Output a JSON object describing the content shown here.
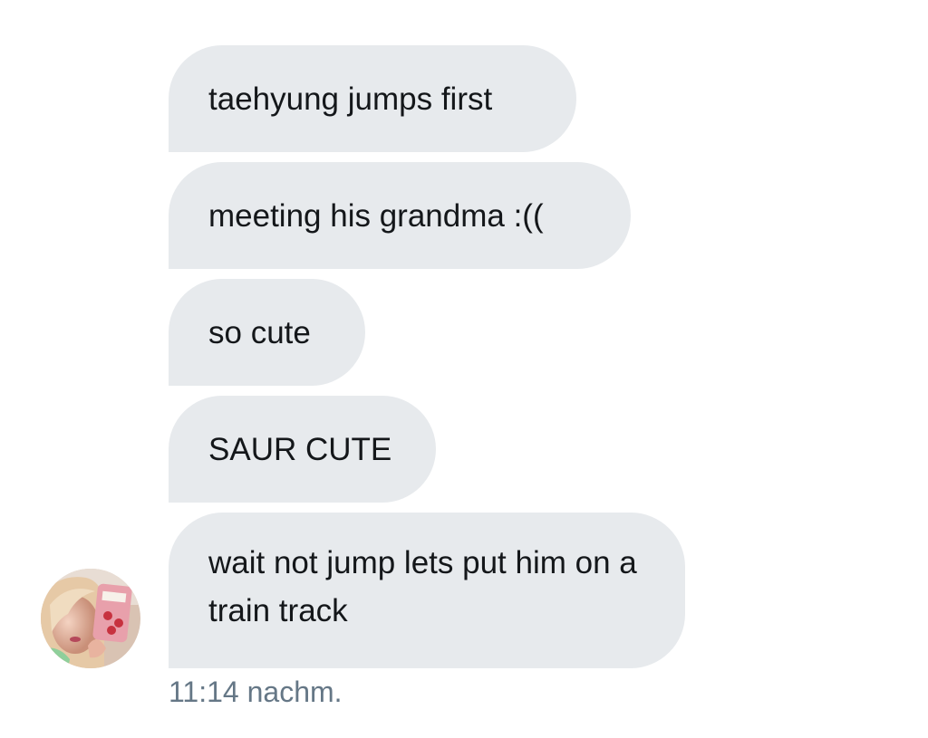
{
  "conversation": {
    "messages": [
      {
        "text": "taehyung jumps first"
      },
      {
        "text": "meeting his grandma :(("
      },
      {
        "text": "so cute"
      },
      {
        "text": "SAUR CUTE"
      },
      {
        "text": "wait not jump lets put him on a train track"
      }
    ],
    "timestamp": "11:14 nachm.",
    "avatar": {
      "icon": "user-avatar-photo"
    }
  },
  "colors": {
    "bubble_bg": "#e7eaed",
    "bubble_text": "#14171a",
    "timestamp_text": "#657786",
    "background": "#ffffff"
  }
}
